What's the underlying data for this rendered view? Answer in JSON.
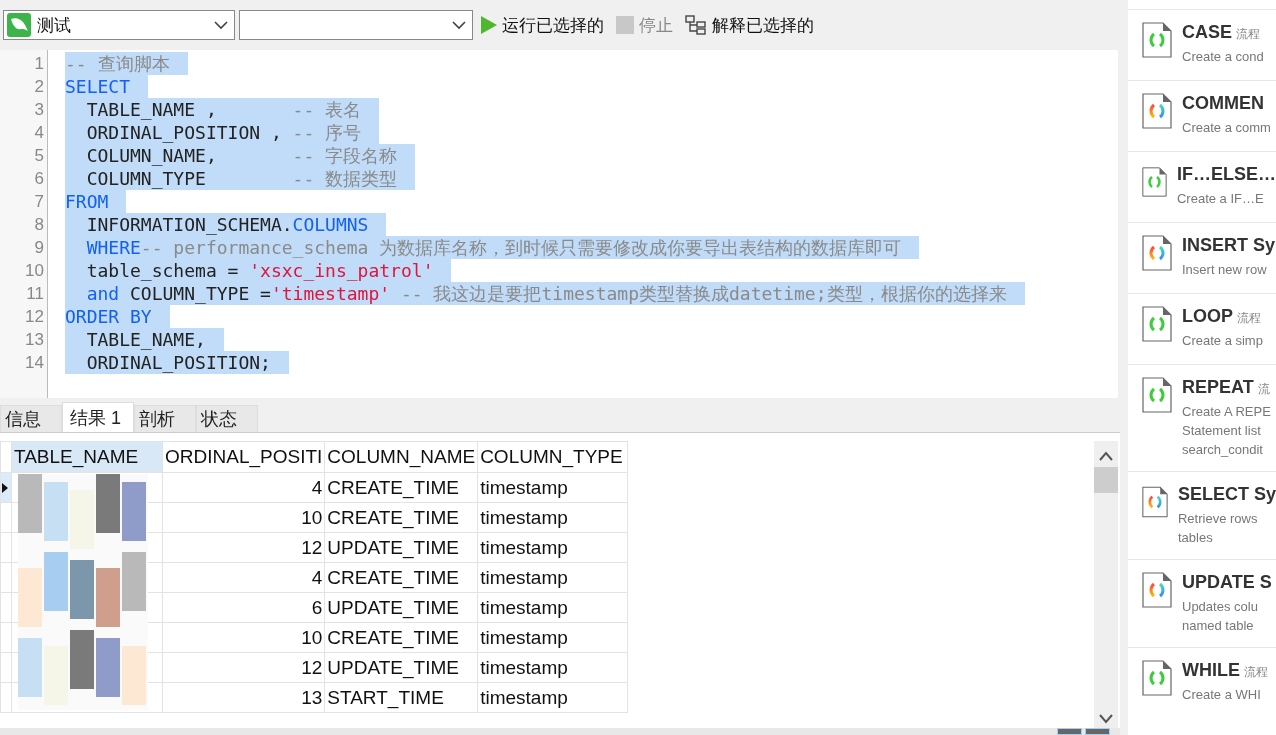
{
  "toolbar": {
    "connection": "测试",
    "buttons": [
      {
        "kind": "run",
        "label": "运行已选择的",
        "disabled": false
      },
      {
        "kind": "stop",
        "label": "停止",
        "disabled": true
      },
      {
        "kind": "explain",
        "label": "解释已选择的",
        "disabled": false
      }
    ]
  },
  "editor": {
    "lines": [
      {
        "number": "1",
        "selected": true,
        "tokens": [
          {
            "kind": "comment",
            "text": "-- 查询脚本"
          }
        ]
      },
      {
        "number": "2",
        "selected": true,
        "tokens": [
          {
            "kind": "keyword",
            "text": "SELECT"
          }
        ]
      },
      {
        "number": "3",
        "selected": true,
        "tokens": [
          {
            "kind": "plain",
            "text": "  TABLE_NAME ,       "
          },
          {
            "kind": "comment",
            "text": "-- 表名"
          }
        ]
      },
      {
        "number": "4",
        "selected": true,
        "tokens": [
          {
            "kind": "plain",
            "text": "  ORDINAL_POSITION , "
          },
          {
            "kind": "comment",
            "text": "-- 序号"
          }
        ]
      },
      {
        "number": "5",
        "selected": true,
        "tokens": [
          {
            "kind": "plain",
            "text": "  COLUMN_NAME,       "
          },
          {
            "kind": "comment",
            "text": "-- 字段名称"
          }
        ]
      },
      {
        "number": "6",
        "selected": true,
        "tokens": [
          {
            "kind": "plain",
            "text": "  COLUMN_TYPE        "
          },
          {
            "kind": "comment",
            "text": "-- 数据类型"
          }
        ]
      },
      {
        "number": "7",
        "selected": true,
        "tokens": [
          {
            "kind": "keyword",
            "text": "FROM"
          }
        ]
      },
      {
        "number": "8",
        "selected": true,
        "tokens": [
          {
            "kind": "plain",
            "text": "  INFORMATION_SCHEMA."
          },
          {
            "kind": "keyword",
            "text": "COLUMNS"
          }
        ]
      },
      {
        "number": "9",
        "selected": true,
        "tokens": [
          {
            "kind": "keyword",
            "text": "  WHERE"
          },
          {
            "kind": "comment",
            "text": "-- performance_schema 为数据库名称，到时候只需要修改成你要导出表结构的数据库即可"
          }
        ]
      },
      {
        "number": "10",
        "selected": true,
        "tokens": [
          {
            "kind": "plain",
            "text": "  table_schema = "
          },
          {
            "kind": "string",
            "text": "'xsxc_ins_patrol'"
          }
        ]
      },
      {
        "number": "11",
        "selected": true,
        "tokens": [
          {
            "kind": "keyword",
            "text": "  and"
          },
          {
            "kind": "plain",
            "text": " COLUMN_TYPE ="
          },
          {
            "kind": "string",
            "text": "'timestamp'"
          },
          {
            "kind": "comment",
            "text": " -- 我这边是要把timestamp类型替换成datetime;类型，根据你的选择来"
          }
        ]
      },
      {
        "number": "12",
        "selected": true,
        "tokens": [
          {
            "kind": "keyword",
            "text": "ORDER BY"
          }
        ]
      },
      {
        "number": "13",
        "selected": true,
        "tokens": [
          {
            "kind": "plain",
            "text": "  TABLE_NAME,"
          }
        ]
      },
      {
        "number": "14",
        "selected": true,
        "tokens": [
          {
            "kind": "plain",
            "text": "  ORDINAL_POSITION;"
          }
        ]
      }
    ]
  },
  "result_tabs": [
    {
      "label": "信息",
      "selected": false
    },
    {
      "label": "结果 1",
      "selected": true
    },
    {
      "label": "剖析",
      "selected": false
    },
    {
      "label": "状态",
      "selected": false
    }
  ],
  "table": {
    "columns": [
      {
        "label": "TABLE_NAME",
        "selected": true
      },
      {
        "label": "ORDINAL_POSITI",
        "selected": false
      },
      {
        "label": "COLUMN_NAME",
        "selected": false
      },
      {
        "label": "COLUMN_TYPE",
        "selected": false
      }
    ],
    "rows": [
      {
        "selected": true,
        "ordinal": "4",
        "column_name": "CREATE_TIME",
        "column_type": "timestamp"
      },
      {
        "selected": false,
        "ordinal": "10",
        "column_name": "CREATE_TIME",
        "column_type": "timestamp"
      },
      {
        "selected": false,
        "ordinal": "12",
        "column_name": "UPDATE_TIME",
        "column_type": "timestamp"
      },
      {
        "selected": false,
        "ordinal": "4",
        "column_name": "CREATE_TIME",
        "column_type": "timestamp"
      },
      {
        "selected": false,
        "ordinal": "6",
        "column_name": "UPDATE_TIME",
        "column_type": "timestamp"
      },
      {
        "selected": false,
        "ordinal": "10",
        "column_name": "CREATE_TIME",
        "column_type": "timestamp"
      },
      {
        "selected": false,
        "ordinal": "12",
        "column_name": "UPDATE_TIME",
        "column_type": "timestamp"
      },
      {
        "selected": false,
        "ordinal": "13",
        "column_name": "START_TIME",
        "column_type": "timestamp"
      }
    ]
  },
  "snippets": [
    {
      "kind": "flow",
      "title": "CASE",
      "tag": "流程",
      "description": [
        "Create a cond"
      ]
    },
    {
      "kind": "syntax",
      "title": "COMMEN",
      "description": [
        "Create a comm"
      ]
    },
    {
      "kind": "flow",
      "title": "IF…ELSE…",
      "description": [
        "Create a IF…E"
      ]
    },
    {
      "kind": "syntax",
      "title": "INSERT Sy",
      "description": [
        "Insert new row"
      ]
    },
    {
      "kind": "flow",
      "title": "LOOP",
      "tag": "流程",
      "description": [
        "Create a simp"
      ]
    },
    {
      "kind": "flow",
      "title": "REPEAT",
      "tag": "流",
      "description": [
        "Create A REPE",
        "Statement list",
        "search_condit"
      ]
    },
    {
      "kind": "syntax",
      "title": "SELECT Sy",
      "description": [
        "Retrieve rows",
        "tables"
      ]
    },
    {
      "kind": "syntax",
      "title": "UPDATE S",
      "description": [
        "Updates colu",
        "named table"
      ]
    },
    {
      "kind": "flow",
      "title": "WHILE",
      "tag": "流程",
      "description": [
        "Create a WHI"
      ]
    }
  ]
}
